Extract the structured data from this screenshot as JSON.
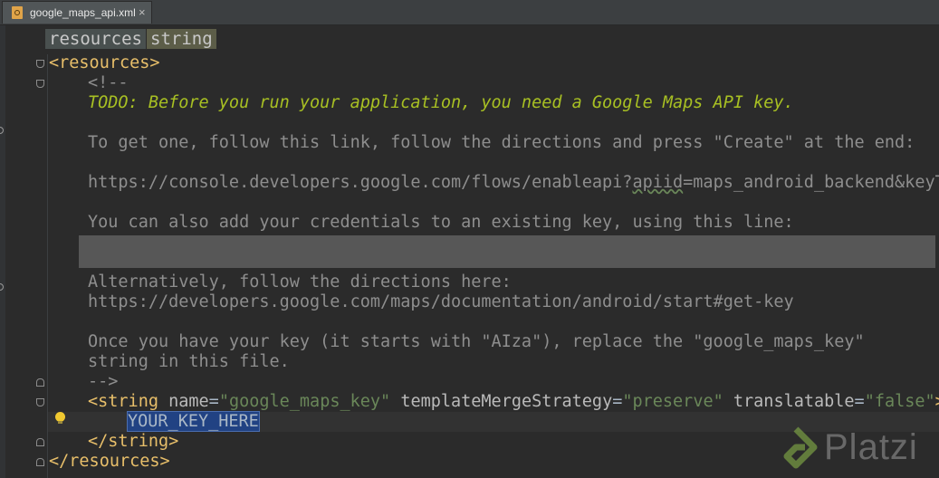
{
  "editor_tab": {
    "file_name": "google_maps_api.xml",
    "close_glyph": "×"
  },
  "breadcrumb": [
    "resources",
    "string"
  ],
  "code": {
    "line1_tag": "<resources>",
    "line2_comment_open": "<!--",
    "line3_todo": "TODO: Before you run your application, you need a Google Maps API key.",
    "line5": "To get one, follow this link, follow the directions and press \"Create\" at the end:",
    "line7_prefix": "https://console.developers.google.com/flows/enableapi?",
    "line7_squiggle": "apiid",
    "line7_suffix": "=maps_android_backend&keyTy",
    "line9": "You can also add your credentials to an existing key, using this line:",
    "line11": "Alternatively, follow the directions here:",
    "line12": "https://developers.google.com/maps/documentation/android/start#get-key",
    "line14": "Once you have your key (it starts with \"AIza\"), replace the \"google_maps_key\"",
    "line15": "string in this file.",
    "line16_comment_close": "-->",
    "line17": {
      "open": "<string",
      "attr1": "name",
      "val1": "\"google_maps_key\"",
      "attr2": "templateMergeStrategy",
      "val2": "\"preserve\"",
      "attr3": "translatable",
      "val3": "\"false\"",
      "close": ">"
    },
    "line18_value": "YOUR_KEY_HERE",
    "line19_tag": "</string>",
    "line20_tag": "</resources>"
  },
  "watermark": {
    "brand": "Platzi"
  },
  "colors": {
    "background": "#2b2b2b",
    "tag": "#e8bf6a",
    "attribute_value": "#6a8759",
    "comment": "#8e8e8e",
    "todo": "#a8c023",
    "selection": "#214283"
  },
  "icons": [
    "xml-file-icon",
    "fold-marker-icon",
    "intention-bulb-icon",
    "platzi-logo-icon"
  ]
}
